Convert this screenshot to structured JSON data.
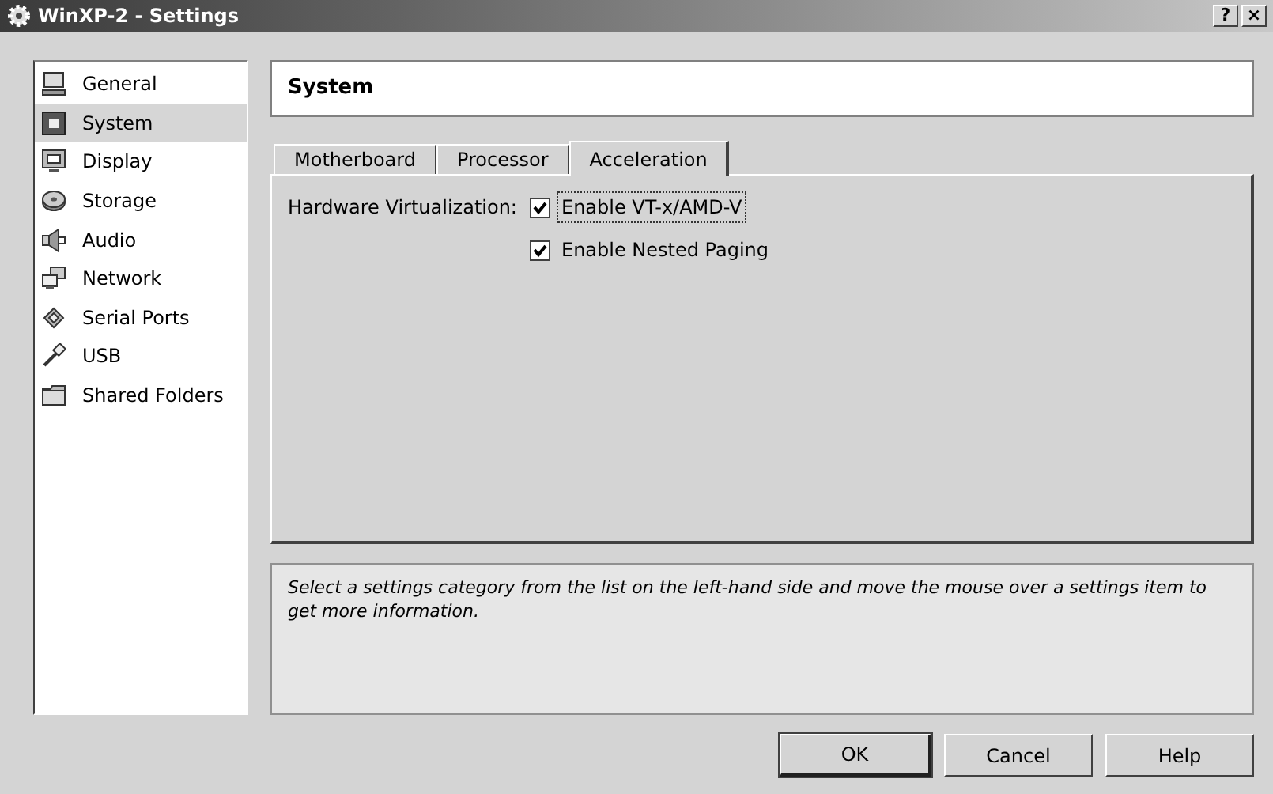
{
  "window": {
    "title": "WinXP-2 - Settings",
    "controls": [
      {
        "label": "?"
      },
      {
        "label": "×"
      }
    ]
  },
  "sidebar": {
    "items": [
      {
        "label": "General",
        "kind": "monitor",
        "selected": false
      },
      {
        "label": "System",
        "kind": "chip",
        "selected": true
      },
      {
        "label": "Display",
        "kind": "display",
        "selected": false
      },
      {
        "label": "Storage",
        "kind": "disk",
        "selected": false
      },
      {
        "label": "Audio",
        "kind": "speaker",
        "selected": false
      },
      {
        "label": "Network",
        "kind": "network",
        "selected": false
      },
      {
        "label": "Serial Ports",
        "kind": "serial",
        "selected": false
      },
      {
        "label": "USB",
        "kind": "usb",
        "selected": false
      },
      {
        "label": "Shared Folders",
        "kind": "folder",
        "selected": false
      }
    ]
  },
  "header": {
    "title": "System"
  },
  "tabs": [
    {
      "label": "Motherboard",
      "selected": false
    },
    {
      "label": "Processor",
      "selected": false
    },
    {
      "label": "Acceleration",
      "selected": true
    }
  ],
  "acceleration": {
    "label": "Hardware Virtualization:",
    "options": [
      {
        "label": "Enable VT-x/AMD-V",
        "checked": true,
        "focused": true
      },
      {
        "label": "Enable Nested Paging",
        "checked": true,
        "focused": false
      }
    ]
  },
  "info": {
    "text": "Select a settings category from the list on the left-hand side and move the mouse over a settings item to get more information."
  },
  "buttons": [
    {
      "label": "OK",
      "default": true
    },
    {
      "label": "Cancel",
      "default": false
    },
    {
      "label": "Help",
      "default": false
    }
  ]
}
